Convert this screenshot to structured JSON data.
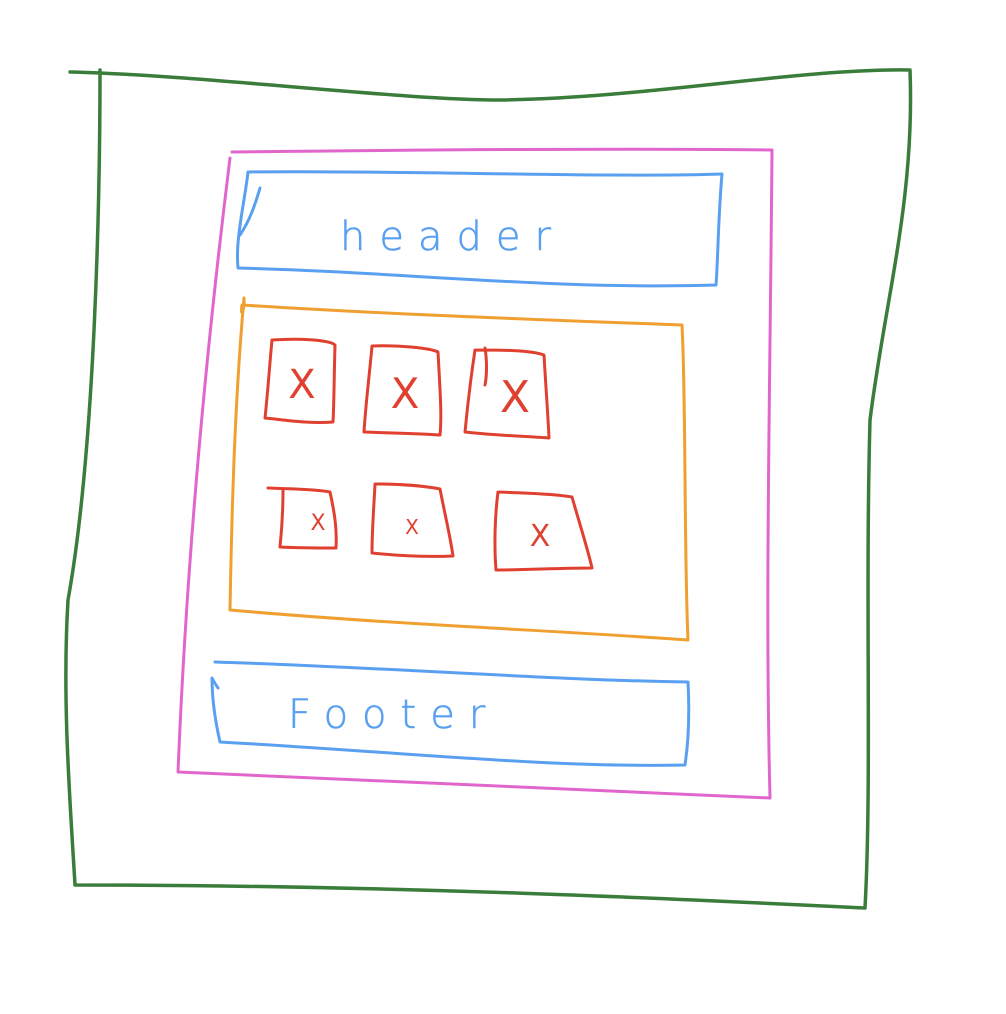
{
  "wireframe": {
    "header_label": "header",
    "footer_label": "Footer",
    "placeholder_mark": "X",
    "colors": {
      "outer_frame": "#3a7d3a",
      "page_container": "#e066cc",
      "header_footer": "#5aa0f0",
      "content_area": "#f0a030",
      "placeholder": "#e04030"
    },
    "content": {
      "rows": 2,
      "columns": 3,
      "placeholder_count": 6
    }
  }
}
